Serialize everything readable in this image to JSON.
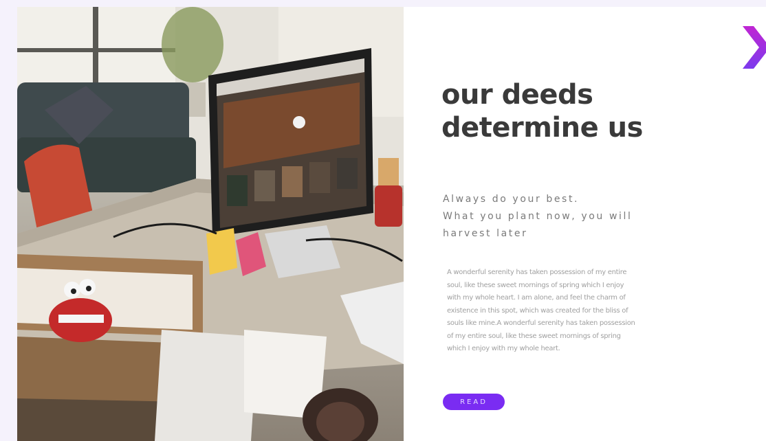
{
  "slide": {
    "heading_line1": "our deeds",
    "heading_line2": "determine us",
    "subtitle_line1": "Always do your best.",
    "subtitle_line2": "What you plant now, you will",
    "subtitle_line3": "harvest later",
    "body_lines": [
      "A wonderful serenity has taken possession of my entire",
      "soul, like these sweet mornings of spring which I enjoy",
      "with my whole heart. I am alone, and feel the charm of",
      "existence in this spot, which was created for the bliss of",
      "souls like mine.A wonderful serenity has taken possession",
      "of my entire soul, like these sweet mornings of spring",
      "which I enjoy with my whole heart."
    ],
    "button_label": "READ"
  },
  "nav": {
    "next_icon": "chevron-right-icon"
  },
  "photo": {
    "subject": "workspace-photo"
  },
  "colors": {
    "accent": "#7a2cf2",
    "arrow_top": "#c026d3",
    "arrow_bottom": "#7c3aed",
    "heading": "#3a3a3a"
  }
}
